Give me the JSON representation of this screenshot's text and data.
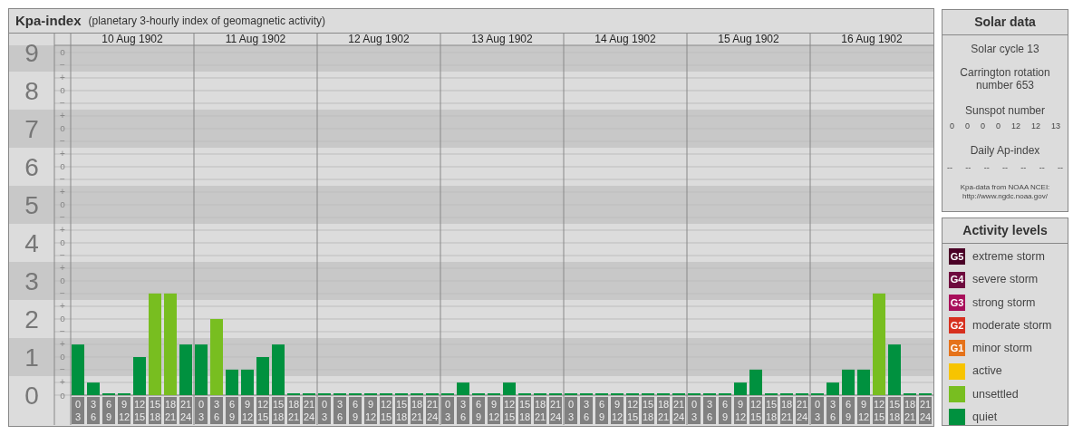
{
  "header": {
    "title": "Kpa-index",
    "subtitle": "(planetary 3-hourly index of geomagnetic activity)"
  },
  "days": [
    "10 Aug 1902",
    "11 Aug 1902",
    "12 Aug 1902",
    "13 Aug 1902",
    "14 Aug 1902",
    "15 Aug 1902",
    "16 Aug 1902"
  ],
  "chart_data": {
    "type": "bar",
    "grid": true,
    "categories": [
      "0 3",
      "3 6",
      "6 9",
      "9 12",
      "12 15",
      "15 18",
      "18 21",
      "21 24",
      "0 3",
      "3 6",
      "6 9",
      "9 12",
      "12 15",
      "15 18",
      "18 21",
      "21 24",
      "0 3",
      "3 6",
      "6 9",
      "9 12",
      "12 15",
      "15 18",
      "18 21",
      "21 24",
      "0 3",
      "3 6",
      "6 9",
      "9 12",
      "12 15",
      "15 18",
      "18 21",
      "21 24",
      "0 3",
      "3 6",
      "6 9",
      "9 12",
      "12 15",
      "15 18",
      "18 21",
      "21 24",
      "0 3",
      "3 6",
      "6 9",
      "9 12",
      "12 15",
      "15 18",
      "18 21",
      "21 24",
      "0 3",
      "3 6",
      "6 9",
      "9 12",
      "12 15",
      "15 18",
      "18 21",
      "21 24"
    ],
    "series": [
      {
        "color": "#00913f",
        "values": [
          1.33,
          0.33,
          0,
          0,
          1,
          null,
          null,
          1.33,
          1.33,
          null,
          0.67,
          0.67,
          1,
          1.33,
          0,
          0,
          0,
          0,
          0,
          0,
          0,
          0,
          0,
          0,
          0,
          0.33,
          0,
          0,
          0.33,
          0,
          0,
          0,
          0,
          0,
          0,
          0,
          0,
          0,
          0,
          0,
          0,
          0,
          0,
          0.33,
          0.67,
          0,
          0,
          0,
          0,
          0.33,
          0.67,
          0.67,
          null,
          1.33,
          0,
          0
        ]
      },
      {
        "color": "#78be20",
        "values": [
          null,
          null,
          null,
          null,
          null,
          2.67,
          2.67,
          null,
          null,
          2,
          null,
          null,
          null,
          null,
          null,
          null,
          null,
          null,
          null,
          null,
          null,
          null,
          null,
          null,
          null,
          null,
          null,
          null,
          null,
          null,
          null,
          null,
          null,
          null,
          null,
          null,
          null,
          null,
          null,
          null,
          null,
          null,
          null,
          null,
          null,
          null,
          null,
          null,
          null,
          null,
          null,
          null,
          2.67,
          null,
          null,
          null
        ]
      }
    ],
    "ylim": [
      0,
      9.19
    ],
    "bands": [
      {
        "axis": "y",
        "from": 0.5,
        "to": 1.5
      },
      {
        "axis": "y",
        "from": 2.5,
        "to": 3.5
      },
      {
        "axis": "y",
        "from": 4.5,
        "to": 5.5
      },
      {
        "axis": "y",
        "from": 6.5,
        "to": 7.5
      },
      {
        "axis": "y",
        "from": 8.5,
        "to": 9.19
      }
    ],
    "yticks": [
      0,
      1,
      2,
      3,
      4,
      5,
      6,
      7,
      8,
      9
    ],
    "annotations": [
      "o",
      "+",
      "−",
      "o",
      "+",
      "−",
      "o",
      "+",
      "−",
      "o",
      "+",
      "−",
      "o",
      "+",
      "−",
      "o",
      "+",
      "−",
      "o",
      "+",
      "−",
      "o",
      "+",
      "−",
      "o",
      "+",
      "−",
      "o"
    ]
  },
  "solar_data": {
    "title": "Solar data",
    "cycle": "Solar cycle 13",
    "rotation": "Carrington rotation number 653",
    "sunspot_label": "Sunspot number",
    "sunspot_numbers": [
      "0",
      "0",
      "0",
      "0",
      "12",
      "12",
      "13"
    ],
    "ap_label": "Daily Ap-index",
    "ap_values": [
      "--",
      "--",
      "--",
      "--",
      "--",
      "--",
      "--"
    ],
    "source": "Kpa-data from NOAA NCEI:",
    "source_url": "http://www.ngdc.noaa.gov/"
  },
  "activity_levels": {
    "title": "Activity levels",
    "items": [
      {
        "badge": "G5",
        "label": "extreme storm",
        "color": "#4a0026"
      },
      {
        "badge": "G4",
        "label": "severe storm",
        "color": "#6e0a3e"
      },
      {
        "badge": "G3",
        "label": "strong storm",
        "color": "#a80f5a"
      },
      {
        "badge": "G2",
        "label": "moderate storm",
        "color": "#d7301f"
      },
      {
        "badge": "G1",
        "label": "minor storm",
        "color": "#e5721a"
      },
      {
        "label": "active",
        "color": "#f7c400"
      },
      {
        "label": "unsettled",
        "color": "#78be20"
      },
      {
        "label": "quiet",
        "color": "#00913f"
      }
    ]
  }
}
